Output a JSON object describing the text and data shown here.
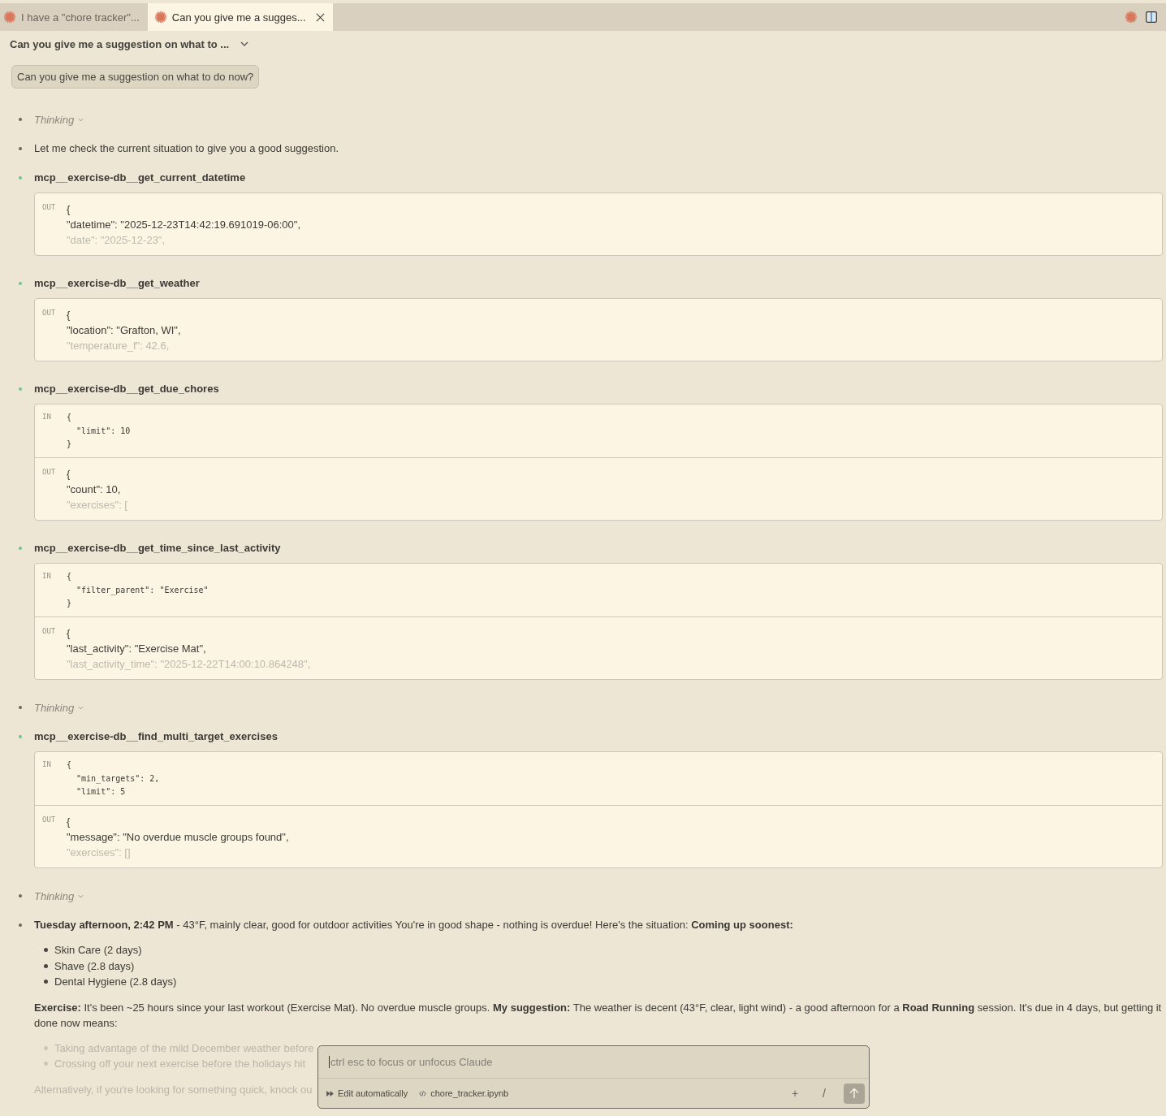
{
  "tabs": [
    {
      "label": "I have a \"chore tracker\"...",
      "selected": false
    },
    {
      "label": "Can you give me a sugges...",
      "selected": true
    }
  ],
  "conversation_title": "Can you give me a suggestion on what to ...",
  "user_message": "Can you give me a suggestion on what to do now?",
  "items": [
    {
      "kind": "thinking",
      "label": "Thinking"
    },
    {
      "kind": "text",
      "text": "Let me check the current situation to give you a good suggestion."
    },
    {
      "kind": "tool",
      "name": "mcp__exercise-db__get_current_datetime",
      "sections": [
        {
          "kind": "output",
          "label": "OUT",
          "lines": [
            "{",
            "\"datetime\": \"2025-12-23T14:42:19.691019-06:00\","
          ],
          "faded_line": "\"date\": \"2025-12-23\","
        }
      ]
    },
    {
      "kind": "tool",
      "name": "mcp__exercise-db__get_weather",
      "sections": [
        {
          "kind": "output",
          "label": "OUT",
          "lines": [
            "{",
            "\"location\": \"Grafton, WI\","
          ],
          "faded_line": "\"temperature_f\": 42.6,"
        }
      ]
    },
    {
      "kind": "tool",
      "name": "mcp__exercise-db__get_due_chores",
      "sections": [
        {
          "kind": "input",
          "label": "IN",
          "lines": [
            "{",
            "  \"limit\": 10",
            "}"
          ]
        },
        {
          "kind": "output",
          "label": "OUT",
          "lines": [
            "{",
            "\"count\": 10,"
          ],
          "faded_line": "\"exercises\": ["
        }
      ]
    },
    {
      "kind": "tool",
      "name": "mcp__exercise-db__get_time_since_last_activity",
      "sections": [
        {
          "kind": "input",
          "label": "IN",
          "lines": [
            "{",
            "  \"filter_parent\": \"Exercise\"",
            "}"
          ]
        },
        {
          "kind": "output",
          "label": "OUT",
          "lines": [
            "{",
            "\"last_activity\": \"Exercise Mat\","
          ],
          "faded_line": "\"last_activity_time\": \"2025-12-22T14:00:10.864248\","
        }
      ]
    },
    {
      "kind": "thinking",
      "label": "Thinking"
    },
    {
      "kind": "tool",
      "name": "mcp__exercise-db__find_multi_target_exercises",
      "sections": [
        {
          "kind": "input",
          "label": "IN",
          "lines": [
            "{",
            "  \"min_targets\": 2,",
            "  \"limit\": 5"
          ]
        },
        {
          "kind": "output",
          "label": "OUT",
          "lines": [
            "{",
            "\"message\": \"No overdue muscle groups found\","
          ],
          "faded_line": "\"exercises\": []"
        }
      ]
    },
    {
      "kind": "thinking",
      "label": "Thinking"
    },
    {
      "kind": "answer",
      "blocks": [
        {
          "kind": "paragraph",
          "faded": false,
          "text": "**Tuesday afternoon, 2:42 PM** - 43°F, mainly clear, good for outdoor activities You're in good shape - nothing is overdue! Here's the situation: **Coming up soonest:**"
        },
        {
          "kind": "list",
          "faded": false,
          "items": [
            "Skin Care (2 days)",
            "Shave (2.8 days)",
            "Dental Hygiene (2.8 days)"
          ]
        },
        {
          "kind": "paragraph",
          "faded": false,
          "text": "**Exercise:** It's been ~25 hours since your last workout (Exercise Mat). No overdue muscle groups. **My suggestion:** The weather is decent (43°F, clear, light wind) - a good afternoon for a **Road Running** session. It's due in 4 days, but getting it done now means:"
        },
        {
          "kind": "list",
          "faded": true,
          "items": [
            "Taking advantage of the mild December weather before",
            "Crossing off your next exercise before the holidays hit"
          ]
        },
        {
          "kind": "paragraph",
          "faded": true,
          "text": "Alternatively, if you're looking for something quick, knock ou"
        }
      ]
    }
  ],
  "composer": {
    "placeholder": "ctrl esc to focus or unfocus Claude",
    "mode": "Edit automatically",
    "file": "chore_tracker.ipynb",
    "add": "+",
    "slash": "/"
  }
}
